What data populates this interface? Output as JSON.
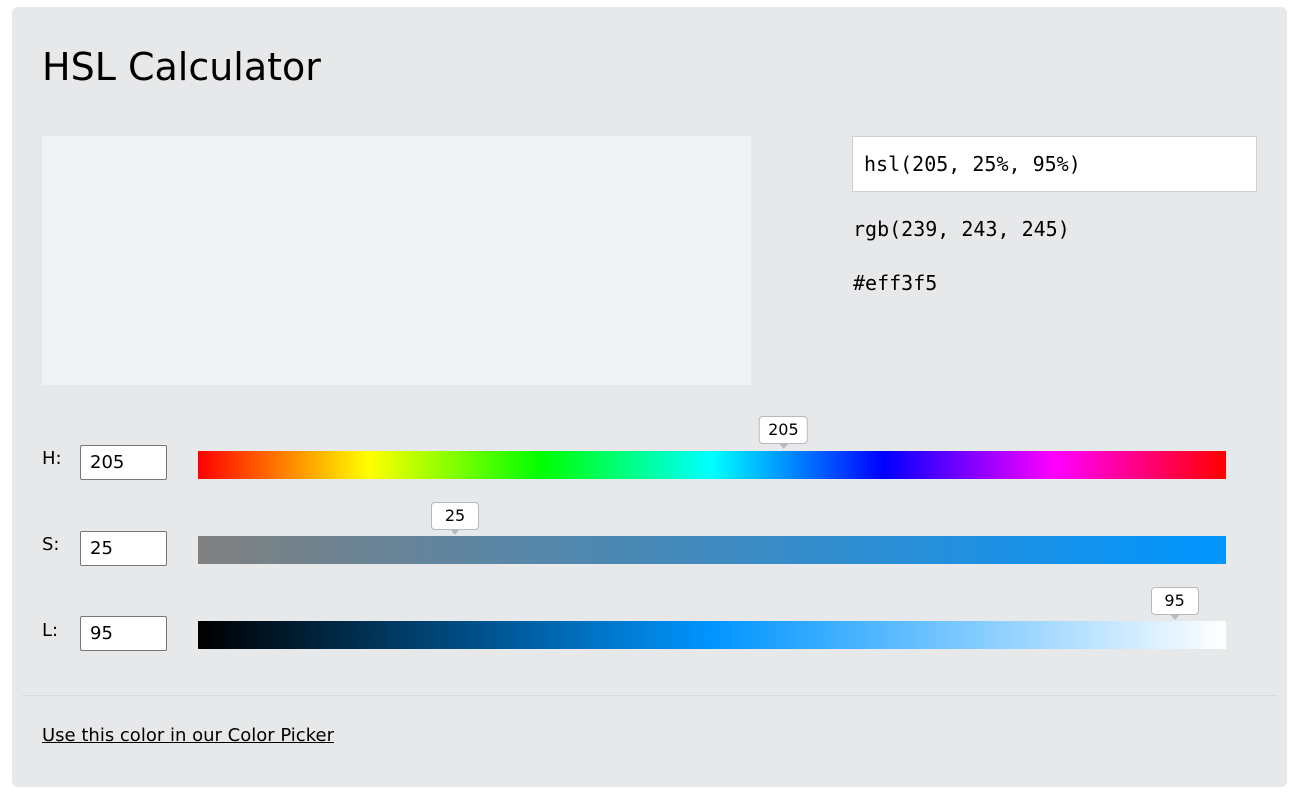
{
  "page": {
    "title": "HSL Calculator"
  },
  "color": {
    "swatch_hex": "#eff3f5",
    "hsl_text": "hsl(205, 25%, 95%)",
    "rgb_text": "rgb(239, 243, 245)",
    "hex_text": "#eff3f5"
  },
  "sliders": {
    "h": {
      "label": "H:",
      "value": "205",
      "min": 0,
      "max": 360
    },
    "s": {
      "label": "S:",
      "value": "25",
      "min": 0,
      "max": 100
    },
    "l": {
      "label": "L:",
      "value": "95",
      "min": 0,
      "max": 100
    }
  },
  "footer": {
    "link_text": "Use this color in our Color Picker"
  }
}
